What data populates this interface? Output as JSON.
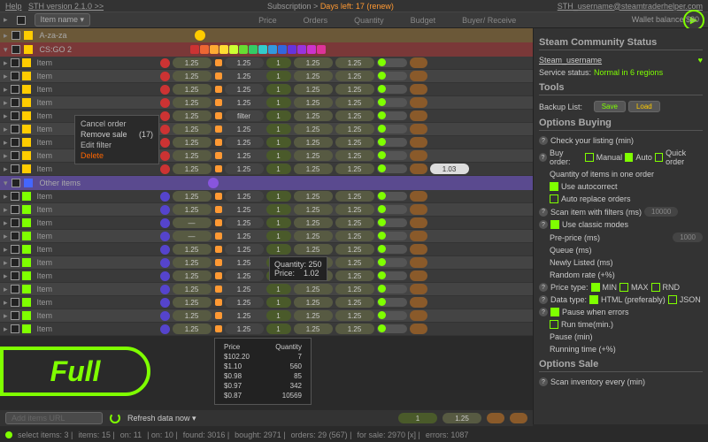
{
  "top": {
    "help": "Help",
    "version": "STH version 2.1.0 >>",
    "sub": "Subscription >",
    "days": "Days left: 17 (renew)",
    "email": "STH_username@steamtraderhelper.com"
  },
  "hdr": {
    "dropdown": "Item name ▾",
    "price": "Price",
    "orders": "Orders",
    "quantity": "Quantity",
    "budget": "Budget",
    "buyer": "Buyer",
    "receive": "/ Receive",
    "wallet": "Wallet balance $80"
  },
  "cats": {
    "az": "A-za-za",
    "cs": "CS:GO 2",
    "oi": "Other items"
  },
  "val": {
    "p": "1.25",
    "d": "—",
    "one": "1",
    "f": "f",
    "filter": "filter",
    "v103": "1.03"
  },
  "ctx": {
    "cancel": "Cancel order",
    "remove": "Remove sale",
    "n": "(17)",
    "edit": "Edit filter",
    "del": "Delete"
  },
  "tt1": {
    "q": "Quantity:",
    "qv": "250",
    "p": "Price:",
    "pv": "1.02"
  },
  "tt2": {
    "hp": "Price",
    "hq": "Quantity",
    "r": [
      [
        "$102.20",
        "7"
      ],
      [
        "$1.10",
        "560"
      ],
      [
        "$0.98",
        "85"
      ],
      [
        "$0.97",
        "342"
      ],
      [
        "$0.87",
        "10569"
      ]
    ]
  },
  "full": "Full",
  "panel": {
    "scs": "Steam Community Status",
    "user": "Steam_username",
    "svc": "Service status:",
    "svcv": "Normal in 6 regions",
    "tools": "Tools",
    "bl": "Backup List:",
    "save": "Save",
    "load": "Load",
    "ob": "Options Buying",
    "cl": "Check your listing (min)",
    "bo": "Buy order:",
    "man": "Manual",
    "auto": "Auto",
    "qo": "Quick order",
    "qio": "Quantity of items in one order",
    "uac": "Use autocorrect",
    "aro": "Auto replace orders",
    "sif": "Scan item with filters (ms)",
    "ucm": "Use classic modes",
    "pp": "Pre-price (ms)",
    "qu": "Queue (ms)",
    "nl": "Newly Listed (ms)",
    "rr": "Random rate (+%)",
    "pt": "Price type:",
    "min": "MIN",
    "max": "MAX",
    "rnd": "RND",
    "dt": "Data type:",
    "html": "HTML (preferably)",
    "json": "JSON",
    "pwe": "Pause when errors",
    "rt": "Run time(min.)",
    "pa": "Pause (min)",
    "rti": "Running time (+%)",
    "os": "Options Sale",
    "sie": "Scan inventory every (min)"
  },
  "bot": {
    "aiu": "Add items URL",
    "rdn": "Refresh data now ▾",
    "v1": "1",
    "v2": "1.25"
  },
  "status": {
    "si": "select items: 3 |",
    "it": "items: 15 |",
    "on": "on: 11",
    "off": "| on: 10 |",
    "fnd": "found: 3016 |",
    "bgt": "bought: 2971 |",
    "ord": "orders: 29 (567) |",
    "fs": "for sale: 2970 [x] |",
    "err": "errors: 1087"
  }
}
